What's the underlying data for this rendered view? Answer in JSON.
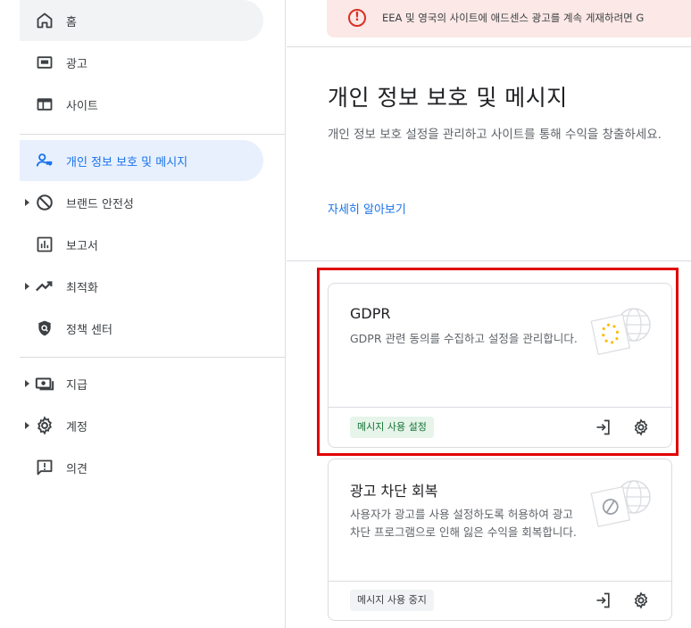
{
  "sidebar": {
    "items": [
      {
        "label": "홈",
        "icon": "home-icon"
      },
      {
        "label": "광고",
        "icon": "ads-icon"
      },
      {
        "label": "사이트",
        "icon": "sites-icon"
      },
      {
        "label": "개인 정보 보호 및 메시지",
        "icon": "privacy-messaging-icon"
      },
      {
        "label": "브랜드 안전성",
        "icon": "block-icon"
      },
      {
        "label": "보고서",
        "icon": "reports-icon"
      },
      {
        "label": "최적화",
        "icon": "trending-up-icon"
      },
      {
        "label": "정책 센터",
        "icon": "policy-shield-icon"
      },
      {
        "label": "지급",
        "icon": "payments-icon"
      },
      {
        "label": "계정",
        "icon": "gear-icon"
      },
      {
        "label": "의견",
        "icon": "feedback-icon"
      }
    ]
  },
  "banner": {
    "text": "EEA 및 영국의 사이트에 애드센스 광고를 계속 게재하려면 G"
  },
  "main": {
    "title": "개인 정보 보호 및 메시지",
    "description": "개인 정보 보호 설정을 관리하고 사이트를 통해 수익을 창출하세요.",
    "learn_more": "자세히 알아보기"
  },
  "cards": [
    {
      "title": "GDPR",
      "description": "GDPR 관련 동의를 수집하고 설정을 관리합니다.",
      "status": "메시지 사용 설정"
    },
    {
      "title": "광고 차단 회복",
      "description": "사용자가 광고를 사용 설정하도록 허용하여 광고 차단 프로그램으로 인해 잃은 수익을 회복합니다.",
      "status": "메시지 사용 중지"
    }
  ],
  "colors": {
    "accent": "#1a73e8",
    "active_bg": "#e8f0fe",
    "banner_bg": "#fce8e6",
    "status_on_bg": "#e6f4ea",
    "status_on_text": "#137333",
    "highlight": "#e00000"
  }
}
